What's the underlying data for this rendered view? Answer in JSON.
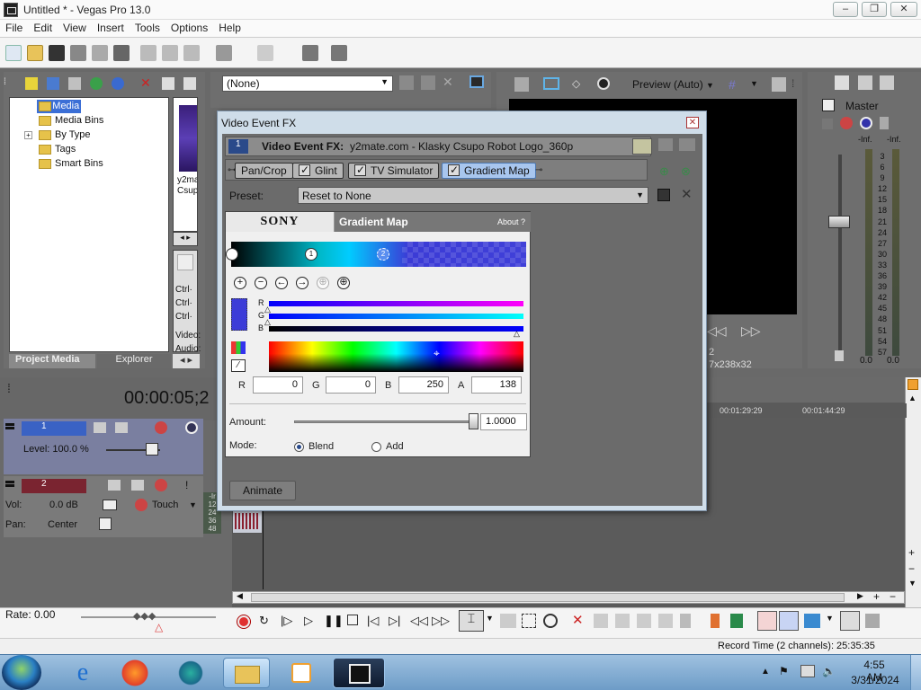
{
  "window": {
    "title": "Untitled * - Vegas Pro 13.0",
    "minimize": "–",
    "maximize": "❐",
    "close": "✕"
  },
  "menu": [
    "File",
    "Edit",
    "View",
    "Insert",
    "Tools",
    "Options",
    "Help"
  ],
  "explorer": {
    "tree": [
      "All Media",
      "Media Bins",
      "By Type",
      "Tags",
      "Smart Bins"
    ],
    "tabs": {
      "project_media": "Project Media",
      "explorer": "Explorer"
    },
    "thumb_caption": [
      "y2ma",
      "Csup"
    ],
    "side_labels": [
      "Ctrl·",
      "Ctrl·",
      "Ctrl·",
      "Video:",
      "Audio:"
    ]
  },
  "fx_dropdown": {
    "value": "(None)"
  },
  "preview": {
    "label": "Preview (Auto)",
    "size_text": "7x238x32",
    "num": "2"
  },
  "master": {
    "label": "Master",
    "inf": "-Inf.",
    "scale": [
      "3",
      "6",
      "9",
      "12",
      "15",
      "18",
      "21",
      "24",
      "27",
      "30",
      "33",
      "36",
      "39",
      "42",
      "45",
      "48",
      "51",
      "54",
      "57"
    ],
    "val": "0.0"
  },
  "dialog": {
    "title": "Video Event FX",
    "track_num": "1",
    "fx_label": "Video Event FX:",
    "fx_name": "y2mate.com - Klasky Csupo Robot Logo_360p",
    "chain": [
      "Pan/Crop",
      "Glint",
      "TV Simulator",
      "Gradient Map"
    ],
    "preset_label": "Preset:",
    "preset_value": "Reset to None",
    "plugin": {
      "brand": "SONY",
      "name": "Gradient Map",
      "about": "About  ?",
      "stops": [
        "1",
        "2"
      ],
      "channels": [
        "R",
        "G",
        "B"
      ],
      "rgba": {
        "r_label": "R",
        "r": "0",
        "g_label": "G",
        "g": "0",
        "b_label": "B",
        "b": "250",
        "a_label": "A",
        "a": "138"
      },
      "amount_label": "Amount:",
      "amount_value": "1.0000",
      "amount": 1.0,
      "mode_label": "Mode:",
      "mode_blend": "Blend",
      "mode_add": "Add"
    },
    "animate": "Animate"
  },
  "timeline": {
    "timecode": "00:00:05;2",
    "ruler": [
      "00:01:29:29",
      "00:01:44:29"
    ],
    "track1": {
      "num": "1",
      "level": "Level: 100.0 %"
    },
    "track2": {
      "num": "2",
      "vol_label": "Vol:",
      "vol": "0.0 dB",
      "pan_label": "Pan:",
      "pan": "Center",
      "touch": "Touch"
    },
    "meter_nums": [
      "-Ir",
      "12",
      "24",
      "36",
      "48"
    ],
    "rate": "Rate: 0.00"
  },
  "status": {
    "record_time": "Record Time (2 channels): 25:35:35"
  },
  "taskbar": {
    "time": "4:55 AM",
    "date": "3/31/2024"
  }
}
